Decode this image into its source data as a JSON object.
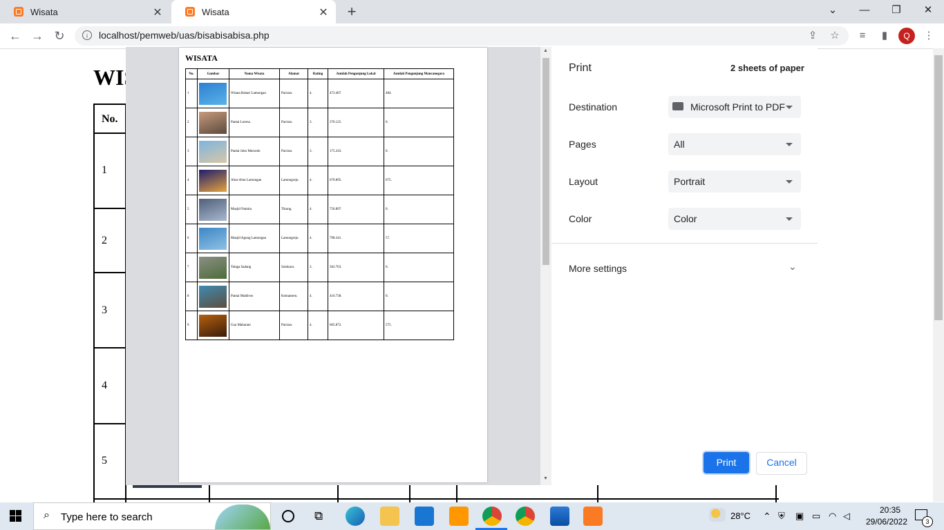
{
  "browser": {
    "tabs": [
      {
        "title": "Wisata",
        "active": false
      },
      {
        "title": "Wisata",
        "active": true
      }
    ],
    "new_tab": "+",
    "url": "localhost/pemweb/uas/bisabisabisa.php",
    "profile_initial": "Q",
    "window_controls": {
      "minimize": "⌄",
      "restore": "—",
      "maximize": "❐",
      "close": "✕"
    }
  },
  "background_page": {
    "title": "WIS",
    "header_no": "No.",
    "row_numbers": [
      "1",
      "2",
      "3",
      "4",
      "5"
    ]
  },
  "print_preview": {
    "title": "WISATA",
    "headers": [
      "No.",
      "Gambar",
      "Nama Wisata",
      "Alamat",
      "Rating",
      "Jumlah Pengunjung Lokal",
      "Jumlah Pengunjung Mancanegara"
    ],
    "rows": [
      {
        "no": "1",
        "nama": "Wisata Bahari Lamongan",
        "alamat": "Paciran.",
        "rating": "4.",
        "lokal": "473.407.",
        "manca": "484.",
        "img": [
          "#2e7fd1",
          "#58b3e8"
        ]
      },
      {
        "no": "2",
        "nama": "Pantai Lorena",
        "alamat": "Paciran.",
        "rating": "3.",
        "lokal": "370.125.",
        "manca": "0.",
        "img": [
          "#c79a7c",
          "#5b4a3e"
        ]
      },
      {
        "no": "3",
        "nama": "Pantai Joko Mursodo",
        "alamat": "Paciran.",
        "rating": "3.",
        "lokal": "175.243.",
        "manca": "0.",
        "img": [
          "#7db4e0",
          "#d8c7a6"
        ]
      },
      {
        "no": "4",
        "nama": "Alun-Alun Lamongan",
        "alamat": "Lamongrejo.",
        "rating": "4.",
        "lokal": "670.895.",
        "manca": "675.",
        "img": [
          "#1e1e6e",
          "#e6a23c"
        ]
      },
      {
        "no": "5",
        "nama": "Masjid Namira",
        "alamat": "Tikung.",
        "rating": "4.",
        "lokal": "756.897.",
        "manca": "0.",
        "img": [
          "#50607a",
          "#a9b7cf"
        ]
      },
      {
        "no": "6",
        "nama": "Masjid Agung Lamongan",
        "alamat": "Lamongrejo.",
        "rating": "4.",
        "lokal": "798.341.",
        "manca": "57.",
        "img": [
          "#3d86c6",
          "#8fc1e3"
        ]
      },
      {
        "no": "7",
        "nama": "Telaga Sadang",
        "alamat": "Solokuro.",
        "rating": "3.",
        "lokal": "362.763.",
        "manca": "0.",
        "img": [
          "#8a8f84",
          "#4d6b3a"
        ]
      },
      {
        "no": "8",
        "nama": "Pantai Maldives",
        "alamat": "Kemantren.",
        "rating": "4.",
        "lokal": "416.738.",
        "manca": "0.",
        "img": [
          "#3f8bb0",
          "#5d4d3e"
        ]
      },
      {
        "no": "9",
        "nama": "Goa Maharani",
        "alamat": "Paciran.",
        "rating": "4.",
        "lokal": "665.872.",
        "manca": "575.",
        "img": [
          "#b5600e",
          "#3a1c0a"
        ]
      }
    ]
  },
  "print_panel": {
    "title": "Print",
    "sheets": "2 sheets of paper",
    "destination_label": "Destination",
    "destination_value": "Microsoft Print to PDF",
    "pages_label": "Pages",
    "pages_value": "All",
    "layout_label": "Layout",
    "layout_value": "Portrait",
    "color_label": "Color",
    "color_value": "Color",
    "more_settings": "More settings",
    "print_button": "Print",
    "cancel_button": "Cancel",
    "accent": "#1a73e8"
  },
  "taskbar": {
    "search_placeholder": "Type here to search",
    "weather": "28°C",
    "time": "20:35",
    "date": "29/06/2022",
    "notifications": "3"
  }
}
